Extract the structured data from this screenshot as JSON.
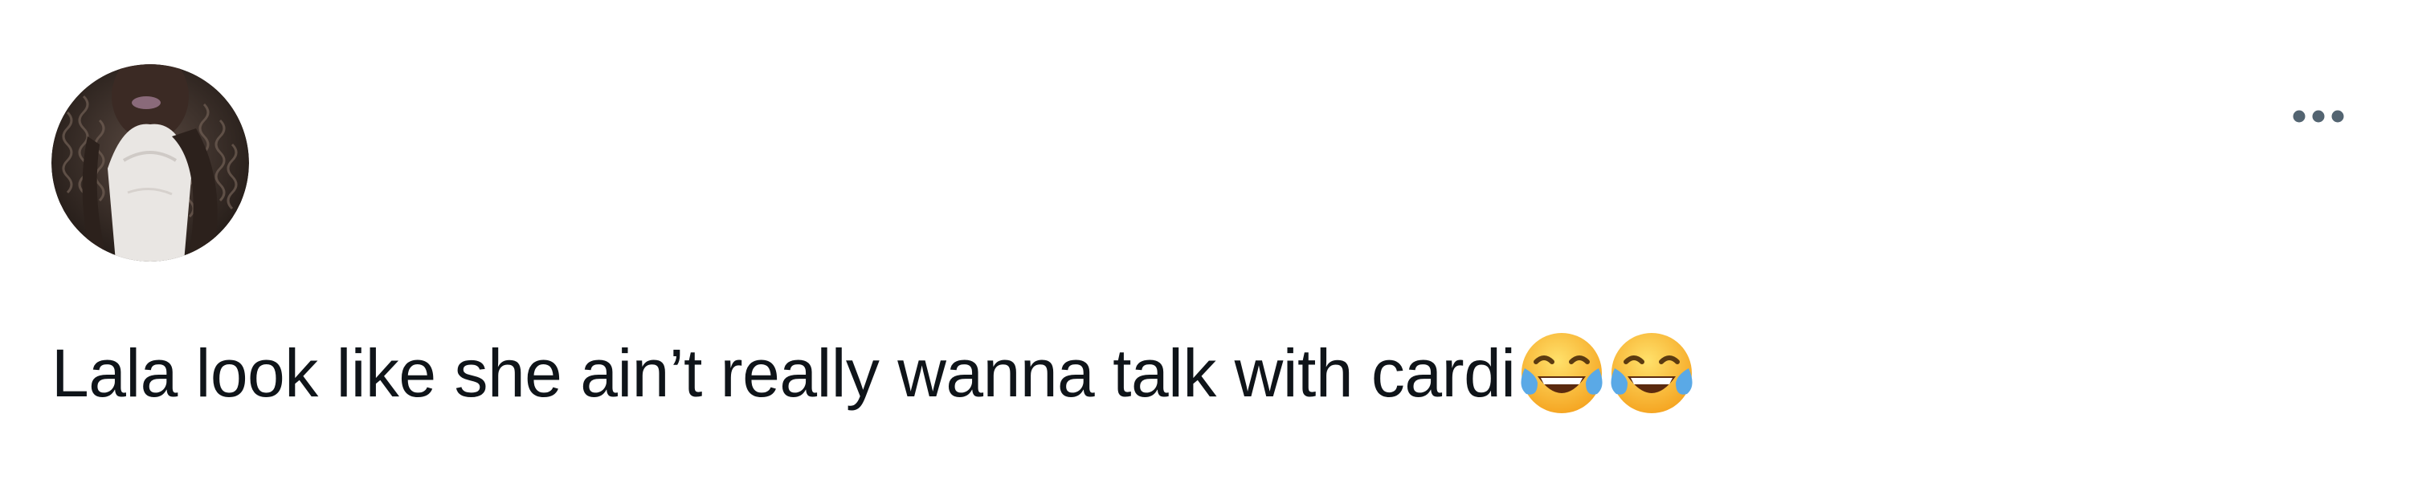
{
  "tweet": {
    "text": "Lala look like she ain’t really wanna talk with cardi",
    "emojis": [
      "face-with-tears-of-joy-icon",
      "face-with-tears-of-joy-icon"
    ]
  },
  "avatar": {
    "icon": "user-avatar-photo"
  },
  "more_menu": {
    "icon": "more-dots-icon"
  },
  "colors": {
    "text": "#0f1419",
    "more_icon": "#536471",
    "background": "#ffffff"
  }
}
